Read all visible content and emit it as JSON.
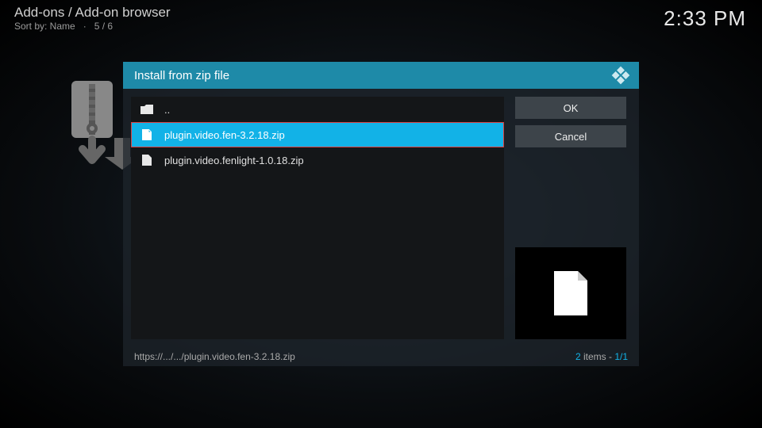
{
  "header": {
    "breadcrumb": "Add-ons / Add-on browser",
    "sort_label": "Sort by: Name",
    "sort_sep": "·",
    "sort_count": "5 / 6"
  },
  "clock": "2:33 PM",
  "dialog": {
    "title": "Install from zip file",
    "buttons": {
      "ok": "OK",
      "cancel": "Cancel"
    },
    "files": {
      "up": "..",
      "item1": "plugin.video.fen-3.2.18.zip",
      "item2": "plugin.video.fenlight-1.0.18.zip"
    },
    "footer": {
      "path": "https://.../.../plugin.video.fen-3.2.18.zip",
      "count_num": "2",
      "count_label": " items - ",
      "page": "1/1"
    }
  }
}
